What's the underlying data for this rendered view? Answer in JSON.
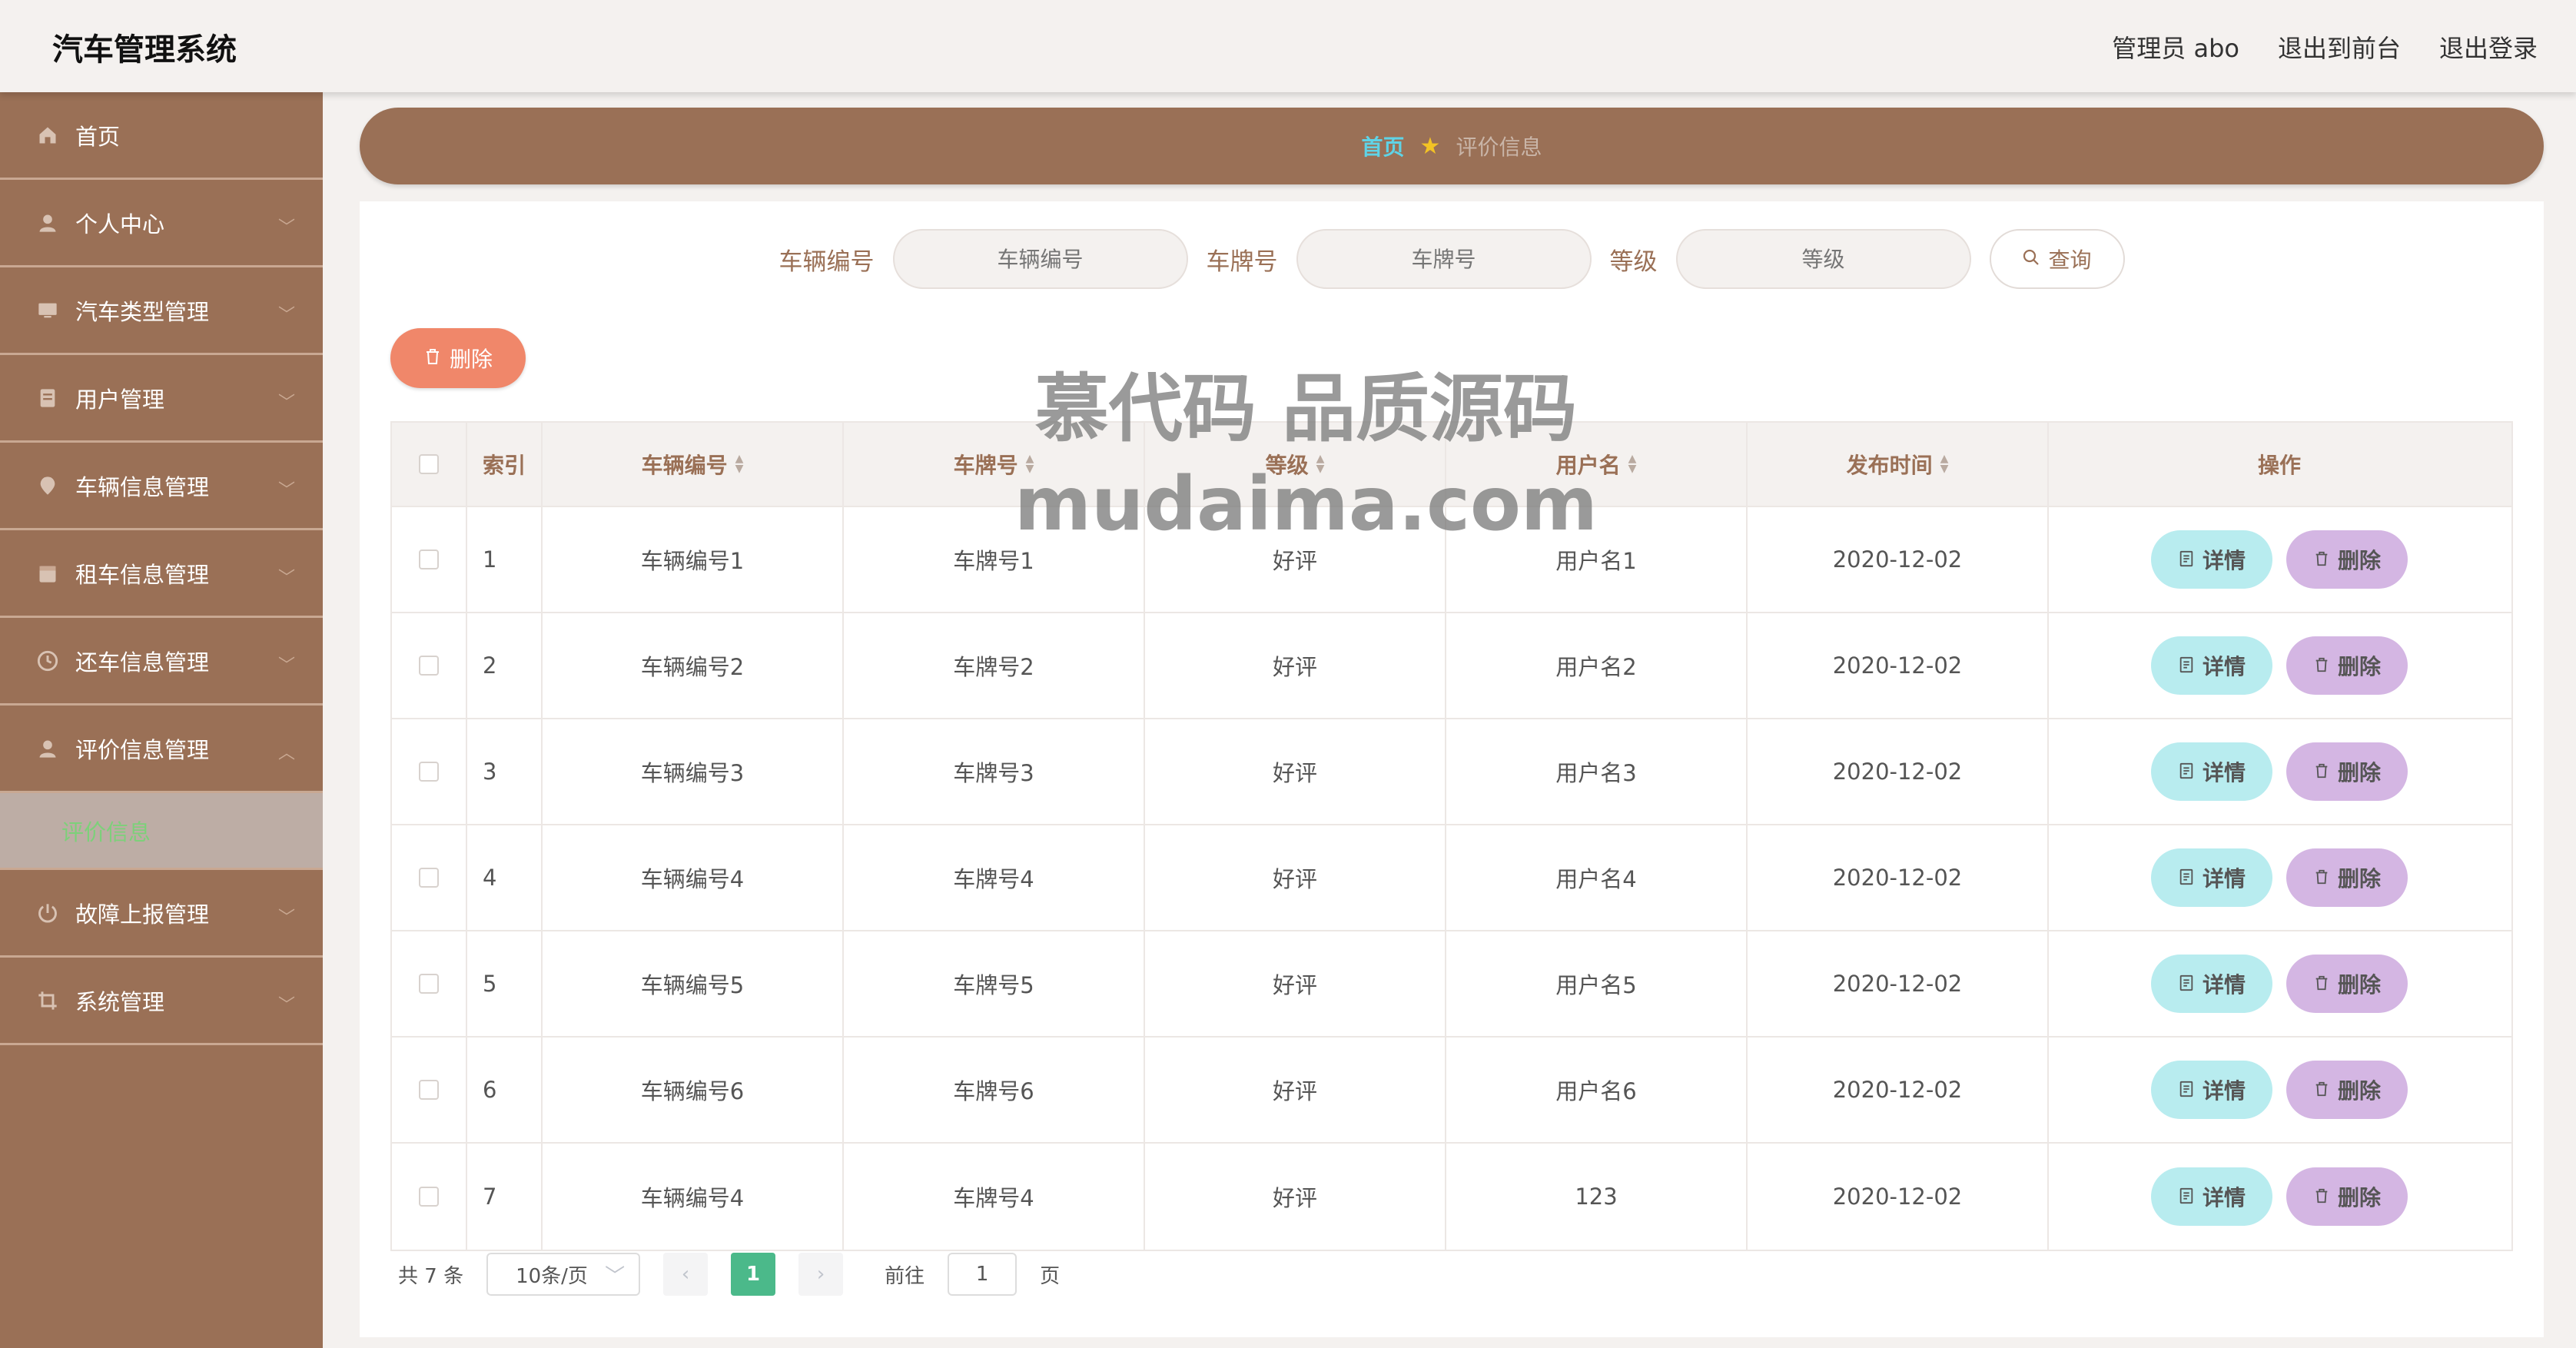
{
  "header": {
    "title": "汽车管理系统",
    "links": [
      "管理员 abo",
      "退出到前台",
      "退出登录"
    ]
  },
  "sidebar": {
    "items": [
      {
        "label": "首页",
        "icon": "home-icon",
        "expandable": false
      },
      {
        "label": "个人中心",
        "icon": "user-icon",
        "expandable": true
      },
      {
        "label": "汽车类型管理",
        "icon": "monitor-icon",
        "expandable": true
      },
      {
        "label": "用户管理",
        "icon": "document-icon",
        "expandable": true
      },
      {
        "label": "车辆信息管理",
        "icon": "pin-icon",
        "expandable": true
      },
      {
        "label": "租车信息管理",
        "icon": "calendar-icon",
        "expandable": true
      },
      {
        "label": "还车信息管理",
        "icon": "clock-icon",
        "expandable": true
      },
      {
        "label": "评价信息管理",
        "icon": "user-icon",
        "expandable": true,
        "expanded": true
      }
    ],
    "active_sub": "评价信息",
    "items_after": [
      {
        "label": "故障上报管理",
        "icon": "power-icon",
        "expandable": true
      },
      {
        "label": "系统管理",
        "icon": "crop-icon",
        "expandable": true
      }
    ]
  },
  "breadcrumb": {
    "home": "首页",
    "current": "评价信息"
  },
  "search": {
    "fields": [
      {
        "label": "车辆编号",
        "placeholder": "车辆编号"
      },
      {
        "label": "车牌号",
        "placeholder": "车牌号"
      },
      {
        "label": "等级",
        "placeholder": "等级"
      }
    ],
    "button": "查询"
  },
  "batch_delete": "删除",
  "table": {
    "columns": [
      "索引",
      "车辆编号",
      "车牌号",
      "等级",
      "用户名",
      "发布时间",
      "操作"
    ],
    "rows": [
      {
        "idx": "1",
        "vehicle_no": "车辆编号1",
        "plate": "车牌号1",
        "grade": "好评",
        "user": "用户名1",
        "time": "2020-12-02"
      },
      {
        "idx": "2",
        "vehicle_no": "车辆编号2",
        "plate": "车牌号2",
        "grade": "好评",
        "user": "用户名2",
        "time": "2020-12-02"
      },
      {
        "idx": "3",
        "vehicle_no": "车辆编号3",
        "plate": "车牌号3",
        "grade": "好评",
        "user": "用户名3",
        "time": "2020-12-02"
      },
      {
        "idx": "4",
        "vehicle_no": "车辆编号4",
        "plate": "车牌号4",
        "grade": "好评",
        "user": "用户名4",
        "time": "2020-12-02"
      },
      {
        "idx": "5",
        "vehicle_no": "车辆编号5",
        "plate": "车牌号5",
        "grade": "好评",
        "user": "用户名5",
        "time": "2020-12-02"
      },
      {
        "idx": "6",
        "vehicle_no": "车辆编号6",
        "plate": "车牌号6",
        "grade": "好评",
        "user": "用户名6",
        "time": "2020-12-02"
      },
      {
        "idx": "7",
        "vehicle_no": "车辆编号4",
        "plate": "车牌号4",
        "grade": "好评",
        "user": "123",
        "time": "2020-12-02"
      }
    ],
    "detail_label": "详情",
    "delete_label": "删除"
  },
  "pagination": {
    "total": "共 7 条",
    "page_size": "10条/页",
    "current_page": "1",
    "goto_label": "前往",
    "goto_value": "1",
    "page_unit": "页"
  },
  "watermark": {
    "line1": "慕代码 品质源码",
    "line2": "mudaima.com"
  }
}
